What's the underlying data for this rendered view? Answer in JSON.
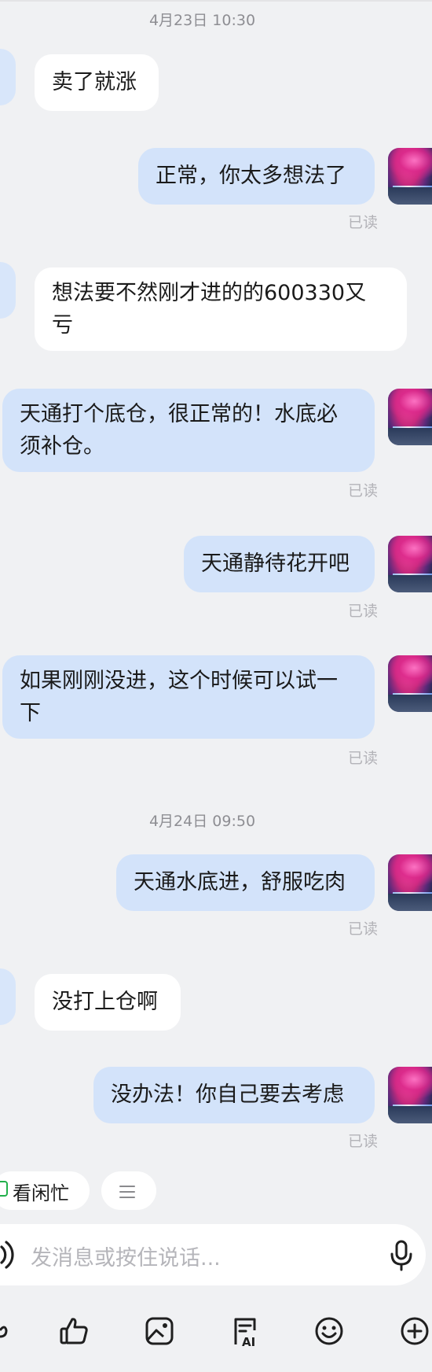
{
  "timestamps": [
    "4月23日 10:30",
    "4月24日 09:50"
  ],
  "messages": [
    {
      "side": "left",
      "text": "卖了就涨"
    },
    {
      "side": "right",
      "text": "正常，你太多想法了",
      "status": "已读"
    },
    {
      "side": "left",
      "lines": [
        "想法要不然刚才进的的600330又",
        "亏"
      ]
    },
    {
      "side": "right",
      "lines": [
        "天通打个底仓，很正常的！水底必",
        "须补仓。"
      ],
      "status": "已读"
    },
    {
      "side": "right",
      "text": "天通静待花开吧",
      "status": "已读"
    },
    {
      "side": "right",
      "lines": [
        "如果刚刚没进，这个时候可以试一",
        "下"
      ],
      "status": "已读"
    },
    {
      "side": "right",
      "text": "天通水底进，舒服吃肉",
      "status": "已读"
    },
    {
      "side": "left",
      "text": "没打上仓啊"
    },
    {
      "side": "right",
      "text": "没办法！你自己要去考虑",
      "status": "已读"
    }
  ],
  "quick_actions": {
    "availability": "看闲忙",
    "menu_icon": "menu-icon"
  },
  "input": {
    "placeholder": "发消息或按住说话...",
    "voice_icon": "sound-wave-icon",
    "mic_icon": "microphone-icon"
  },
  "toolbar": {
    "icons": [
      "partial-icon",
      "thumbs-up-icon",
      "image-icon",
      "ai-writing-icon",
      "emoji-icon",
      "plus-icon"
    ],
    "ai_badge": "AI"
  },
  "colors": {
    "background": "#f0f1f3",
    "incoming_bubble": "#ffffff",
    "outgoing_bubble": "#d3e3fa",
    "read_status": "#b3b3b8"
  }
}
